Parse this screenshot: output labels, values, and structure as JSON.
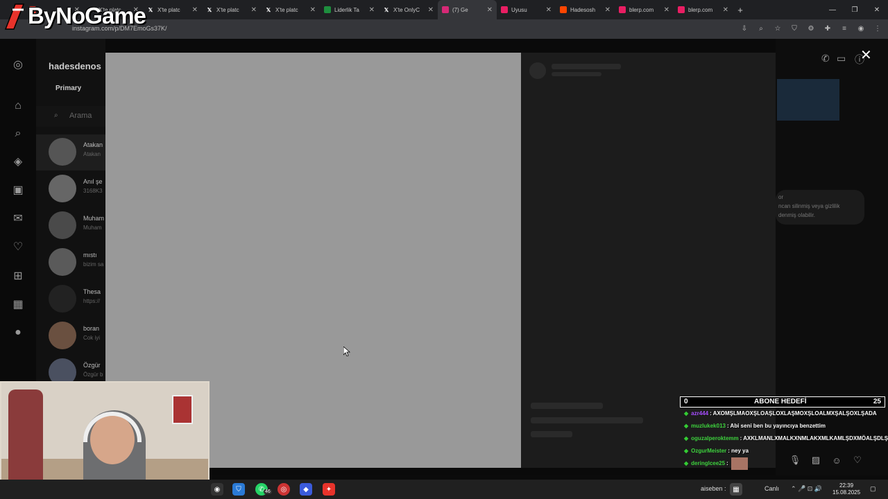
{
  "logo": {
    "text": "ByNoGame"
  },
  "browser": {
    "tabs": [
      {
        "label": "...",
        "color": "#e8453c"
      },
      {
        "label": "X'te platc",
        "color": "#ffffff"
      },
      {
        "label": "X'te platc",
        "color": "#ffffff"
      },
      {
        "label": "X'te platc",
        "color": "#ffffff"
      },
      {
        "label": "X'te platc",
        "color": "#ffffff"
      },
      {
        "label": "Liderlik Ta",
        "color": "#1e8e3e"
      },
      {
        "label": "X'te OnlyC",
        "color": "#ffffff"
      },
      {
        "label": "(7) Ge",
        "color": "#d62976"
      },
      {
        "label": "Uyusu",
        "color": "#e91e63"
      },
      {
        "label": "Hadesosh",
        "color": "#ff4500"
      },
      {
        "label": "blerp.com",
        "color": "#e91e63"
      },
      {
        "label": "blerp.com",
        "color": "#e91e63"
      }
    ],
    "url": "instagram.com/p/DM7EmoGs37K/"
  },
  "instagram": {
    "username": "hadesdenos",
    "primary_tab": "Primary",
    "search_placeholder": "Arama",
    "conversations": [
      {
        "name": "Atakan",
        "snippet": "Atakan"
      },
      {
        "name": "Anıl şe",
        "snippet": "3168K3"
      },
      {
        "name": "Muham",
        "snippet": "Muham"
      },
      {
        "name": "mıstı",
        "snippet": "bizim sa"
      },
      {
        "name": "Thesa",
        "snippet": "https://"
      },
      {
        "name": "boran",
        "snippet": "Cok iyi"
      },
      {
        "name": "Özgür",
        "snippet": "Özgür b"
      }
    ],
    "right_notice": [
      "or",
      "ncan silinmiş veya gizlilik",
      "denmiş olabilir."
    ]
  },
  "overlay": {
    "goal": {
      "left": "0",
      "title": "ABONE HEDEFİ",
      "right": "25"
    },
    "chat": [
      {
        "user": "azr444",
        "user_color": "#a64dff",
        "message": ": AXOMŞLMAOXŞLOAŞLOXLAŞMOXŞLOALMXŞALŞOXLŞADA"
      },
      {
        "user": "muzlukek013",
        "user_color": "#3dd13d",
        "message": ": Abi seni ben bu yayıncıya benzettim"
      },
      {
        "user": "oguzalperoktemm",
        "user_color": "#3dd13d",
        "message": ": AXKLMANLXMALKXNMLAKXMLKAMLŞDXMÖALŞDLŞXMÖA"
      },
      {
        "user": "OzgurMeister",
        "user_color": "#3dd13d",
        "message": ": ney ya"
      },
      {
        "user": "deringlcee25",
        "user_color": "#3dd13d",
        "message": ":"
      }
    ]
  },
  "taskbar": {
    "badge": "46",
    "weather_user": "aiseben :",
    "live_label": "Canlı",
    "time": "22:39",
    "date": "15.08.2025"
  }
}
